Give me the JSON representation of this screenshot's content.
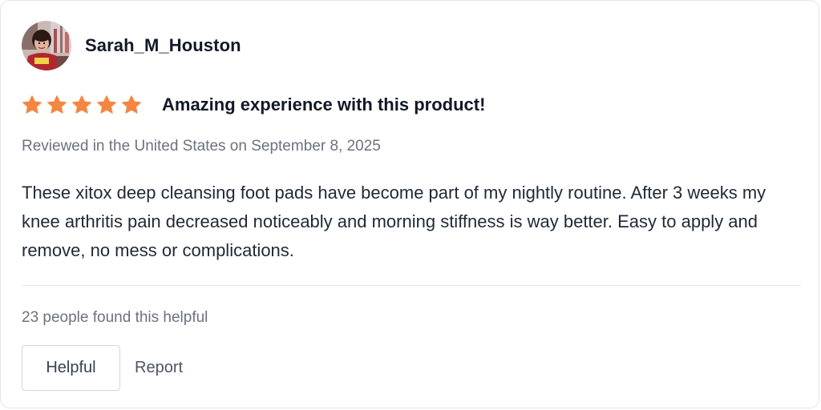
{
  "review": {
    "author": "Sarah_M_Houston",
    "rating": 5,
    "rating_max": 5,
    "star_color": "#f5853f",
    "title": "Amazing experience with this product!",
    "meta": "Reviewed in the United States on September 8, 2025",
    "body": "These xitox deep cleansing foot pads have become part of my nightly routine. After 3 weeks my knee arthritis pain decreased noticeably and morning stiffness is way better. Easy to apply and remove, no mess or complications.",
    "helpful_count_text": "23 people found this helpful"
  },
  "actions": {
    "helpful_label": "Helpful",
    "report_label": "Report"
  },
  "icons": {
    "avatar": "user-avatar-photo",
    "star": "star-icon"
  }
}
